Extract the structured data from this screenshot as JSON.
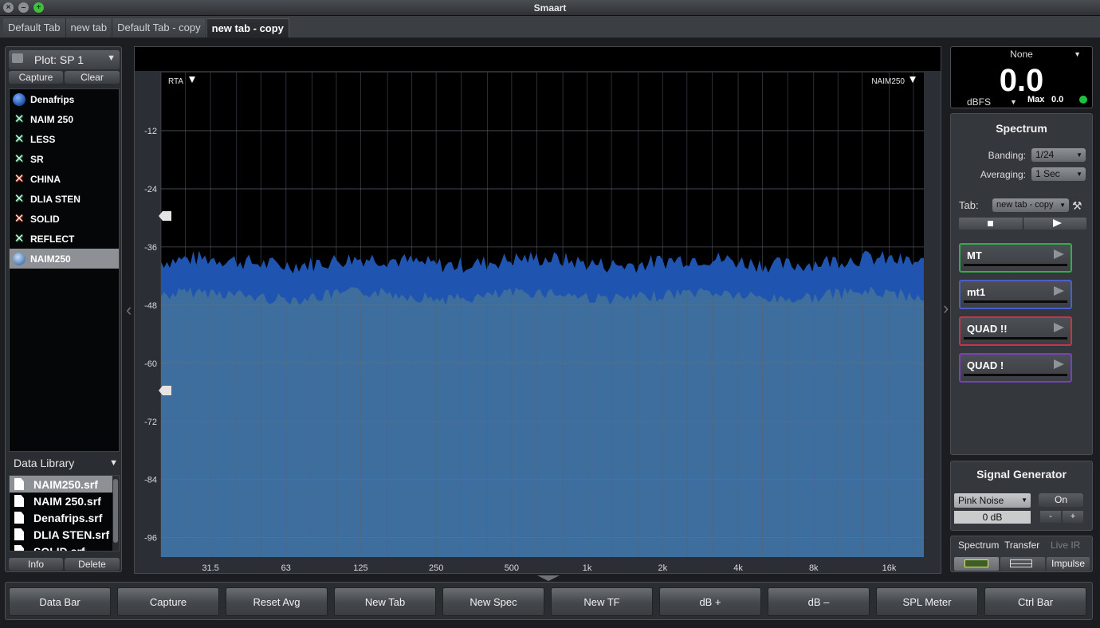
{
  "window": {
    "title": "Smaart"
  },
  "tabs": [
    {
      "label": "Default Tab",
      "active": false
    },
    {
      "label": "new tab",
      "active": false
    },
    {
      "label": "Default Tab - copy",
      "active": false
    },
    {
      "label": "new tab - copy",
      "active": true
    }
  ],
  "left_panel": {
    "plot_select": "Plot: SP 1",
    "capture_label": "Capture",
    "clear_label": "Clear",
    "traces": [
      {
        "label": "Denafrips",
        "icon": "circle-blue",
        "selected": false
      },
      {
        "label": "NAIM 250",
        "icon": "x-green",
        "selected": false
      },
      {
        "label": "LESS",
        "icon": "x-green",
        "selected": false
      },
      {
        "label": "SR",
        "icon": "x-green",
        "selected": false
      },
      {
        "label": "CHINA",
        "icon": "x-red",
        "selected": false
      },
      {
        "label": "DLIA STEN",
        "icon": "x-green",
        "selected": false
      },
      {
        "label": "SOLID",
        "icon": "x-red",
        "selected": false
      },
      {
        "label": "REFLECT",
        "icon": "x-green",
        "selected": false
      },
      {
        "label": "NAIM250",
        "icon": "circle-grey",
        "selected": true
      }
    ],
    "data_library_label": "Data Library",
    "library_files": [
      {
        "label": "NAIM250.srf",
        "selected": true
      },
      {
        "label": "NAIM 250.srf",
        "selected": false
      },
      {
        "label": "Denafrips.srf",
        "selected": false
      },
      {
        "label": "DLIA STEN.srf",
        "selected": false
      },
      {
        "label": "SOLID.srf",
        "selected": false
      }
    ],
    "info_label": "Info",
    "delete_label": "Delete"
  },
  "plot": {
    "rta_label": "RTA",
    "trace_name_label": "NAIM250",
    "y_ticks": [
      "-12",
      "-24",
      "-36",
      "-48",
      "-60",
      "-72",
      "-84",
      "-96"
    ],
    "x_ticks": [
      "31.5",
      "63",
      "125",
      "250",
      "500",
      "1k",
      "2k",
      "4k",
      "8k",
      "16k"
    ],
    "fill_level_db": -43,
    "fill_color": "#3d6e9e",
    "trace_color": "#1f55b0"
  },
  "meter": {
    "source": "None",
    "value": "0.0",
    "unit": "dBFS",
    "max_label": "Max",
    "max_value": "0.0",
    "status_color": "#20c040"
  },
  "spectrum_panel": {
    "title": "Spectrum",
    "banding_label": "Banding:",
    "banding_value": "1/24",
    "averaging_label": "Averaging:",
    "averaging_value": "1 Sec",
    "tab_label": "Tab:",
    "tab_value": "new tab - copy",
    "measurements": [
      {
        "label": "MT",
        "color": "#2fae49"
      },
      {
        "label": "mt1",
        "color": "#4a5fc8"
      },
      {
        "label": "QUAD  !!",
        "color": "#c8334a"
      },
      {
        "label": "QUAD !",
        "color": "#7a3fc0"
      }
    ]
  },
  "signal_generator": {
    "title": "Signal Generator",
    "type_value": "Pink Noise",
    "level_value": "0 dB",
    "on_label": "On",
    "minus_label": "-",
    "plus_label": "+"
  },
  "mode_panel": {
    "spectrum_label": "Spectrum",
    "transfer_label": "Transfer",
    "live_ir_label": "Live IR",
    "impulse_label": "Impulse"
  },
  "bottom_bar": [
    "Data Bar",
    "Capture",
    "Reset Avg",
    "New Tab",
    "New Spec",
    "New TF",
    "dB +",
    "dB –",
    "SPL Meter",
    "Ctrl Bar"
  ]
}
